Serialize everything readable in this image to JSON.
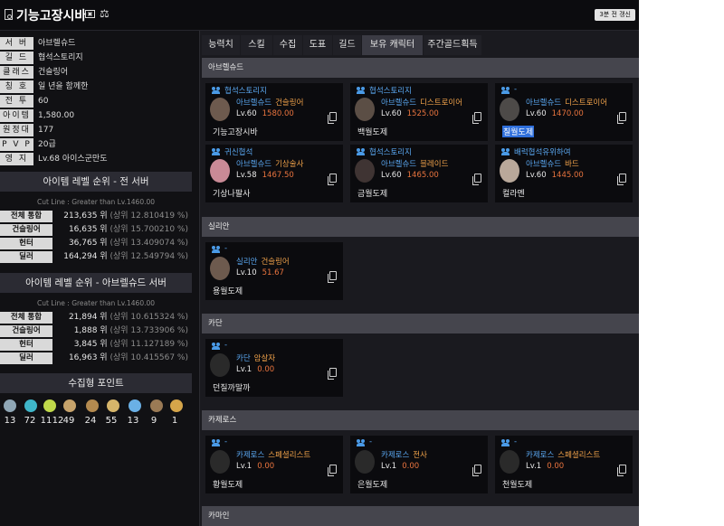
{
  "header": {
    "title": "기능고장시바",
    "badge": "3분 전 갱신"
  },
  "profile": [
    {
      "label": "서 버",
      "value": "아브렐슈드"
    },
    {
      "label": "길 드",
      "value": "협석스토리지"
    },
    {
      "label": "클래스",
      "value": "건슬링어"
    },
    {
      "label": "칭 호",
      "value": "일 년을 함께한"
    },
    {
      "label": "전 투",
      "value": "60"
    },
    {
      "label": "아이템",
      "value": "1,580.00"
    },
    {
      "label": "원정대",
      "value": "177"
    },
    {
      "label": "P V P",
      "value": "20급"
    },
    {
      "label": "영 지",
      "value": "Lv.68 아이스군만도"
    }
  ],
  "rank_all": {
    "title": "아이템 레벨 순위 - 전 서버",
    "cutline": "Cut Line : Greater than Lv.1460.00",
    "rows": [
      {
        "label": "전체 통합",
        "rank": "213,635 위",
        "pct": "(상위 12.810419 %)"
      },
      {
        "label": "건슬링어",
        "rank": "16,635 위",
        "pct": "(상위 15.700210 %)"
      },
      {
        "label": "헌터",
        "rank": "36,765 위",
        "pct": "(상위 13.409074 %)"
      },
      {
        "label": "딜러",
        "rank": "164,294 위",
        "pct": "(상위 12.549794 %)"
      }
    ]
  },
  "rank_server": {
    "title": "아이템 레벨 순위 - 아브렐슈드 서버",
    "cutline": "Cut Line : Greater than Lv.1460.00",
    "rows": [
      {
        "label": "전체 통합",
        "rank": "21,894 위",
        "pct": "(상위 10.615324 %)"
      },
      {
        "label": "건슬링어",
        "rank": "1,888 위",
        "pct": "(상위 13.733906 %)"
      },
      {
        "label": "헌터",
        "rank": "3,845 위",
        "pct": "(상위 11.127189 %)"
      },
      {
        "label": "딜러",
        "rank": "16,963 위",
        "pct": "(상위 10.415567 %)"
      }
    ]
  },
  "collection": {
    "title": "수집형 포인트",
    "items": [
      {
        "icon": "island-heart-icon",
        "value": "13",
        "color": "#8fa6b5"
      },
      {
        "icon": "orpheus-star-icon",
        "value": "72",
        "color": "#3fb6c9"
      },
      {
        "icon": "giant-heart-icon",
        "value": "11",
        "color": "#c0d84a"
      },
      {
        "icon": "art-icon",
        "value": "12",
        "color": "#c7a36b"
      },
      {
        "icon": "mokoko-seed-icon",
        "value": "49",
        "color": "#b48a4f"
      },
      {
        "icon": "world-tree-leaf-icon",
        "value": "24",
        "color": "#d6b56a"
      },
      {
        "icon": "igneas-token-icon",
        "value": "55",
        "color": "#6ab0e6"
      },
      {
        "icon": "voyage-icon",
        "value": "13",
        "color": "#9a7a55"
      },
      {
        "icon": "ignea-icon",
        "value": "9",
        "color": "#d5a54a"
      },
      {
        "icon": "tree-icon",
        "value": "1",
        "color": "#b09a7a"
      }
    ]
  },
  "tabs": [
    "능력치",
    "스킬",
    "수집",
    "도표",
    "길드",
    "보유 캐릭터",
    "주간골드획득"
  ],
  "active_tab": "보유 캐릭터",
  "servers": [
    {
      "name": "아브렐슈드",
      "characters": [
        {
          "guild": "협석스토리지",
          "server": "아브렐슈드",
          "class": "건슬링어",
          "level": "Lv.60",
          "ilvl": "1580.00",
          "name": "기능고장시바",
          "avatar": "#6d5a4e"
        },
        {
          "guild": "협석스토리지",
          "server": "아브렐슈드",
          "class": "디스트로이어",
          "level": "Lv.60",
          "ilvl": "1525.00",
          "name": "백월도제",
          "avatar": "#5b4e45"
        },
        {
          "guild": "-",
          "server": "아브렐슈드",
          "class": "디스트로이어",
          "level": "Lv.60",
          "ilvl": "1470.00",
          "name": "칠월도제",
          "avatar": "#4d4a48",
          "highlight": true
        },
        {
          "guild": "귀신협석",
          "server": "아브렐슈드",
          "class": "기상술사",
          "level": "Lv.58",
          "ilvl": "1467.50",
          "name": "기상나팔사",
          "avatar": "#c98a96"
        },
        {
          "guild": "협석스토리지",
          "server": "아브렐슈드",
          "class": "블레이드",
          "level": "Lv.60",
          "ilvl": "1465.00",
          "name": "금월도제",
          "avatar": "#3f3433"
        },
        {
          "guild": "배럭협석유위하여",
          "server": "아브렐슈드",
          "class": "바드",
          "level": "Lv.60",
          "ilvl": "1445.00",
          "name": "컬라멘",
          "avatar": "#b9a89a"
        }
      ]
    },
    {
      "name": "실리안",
      "characters": [
        {
          "guild": "-",
          "server": "실리안",
          "class": "건슬링어",
          "level": "Lv.10",
          "ilvl": "51.67",
          "name": "용월도제",
          "avatar": "#6d5a4e"
        }
      ]
    },
    {
      "name": "카단",
      "characters": [
        {
          "guild": "-",
          "server": "카단",
          "class": "암살자",
          "level": "Lv.1",
          "ilvl": "0.00",
          "name": "던질까말까",
          "avatar": "#2a2a2a"
        }
      ]
    },
    {
      "name": "카제로스",
      "characters": [
        {
          "guild": "-",
          "server": "카제로스",
          "class": "스페셜리스트",
          "level": "Lv.1",
          "ilvl": "0.00",
          "name": "황월도제",
          "avatar": "#2a2a2a"
        },
        {
          "guild": "-",
          "server": "카제로스",
          "class": "전사",
          "level": "Lv.1",
          "ilvl": "0.00",
          "name": "은월도제",
          "avatar": "#2a2a2a"
        },
        {
          "guild": "-",
          "server": "카제로스",
          "class": "스페셜리스트",
          "level": "Lv.1",
          "ilvl": "0.00",
          "name": "천월도제",
          "avatar": "#2a2a2a"
        }
      ]
    },
    {
      "name": "카마인",
      "characters": []
    }
  ]
}
